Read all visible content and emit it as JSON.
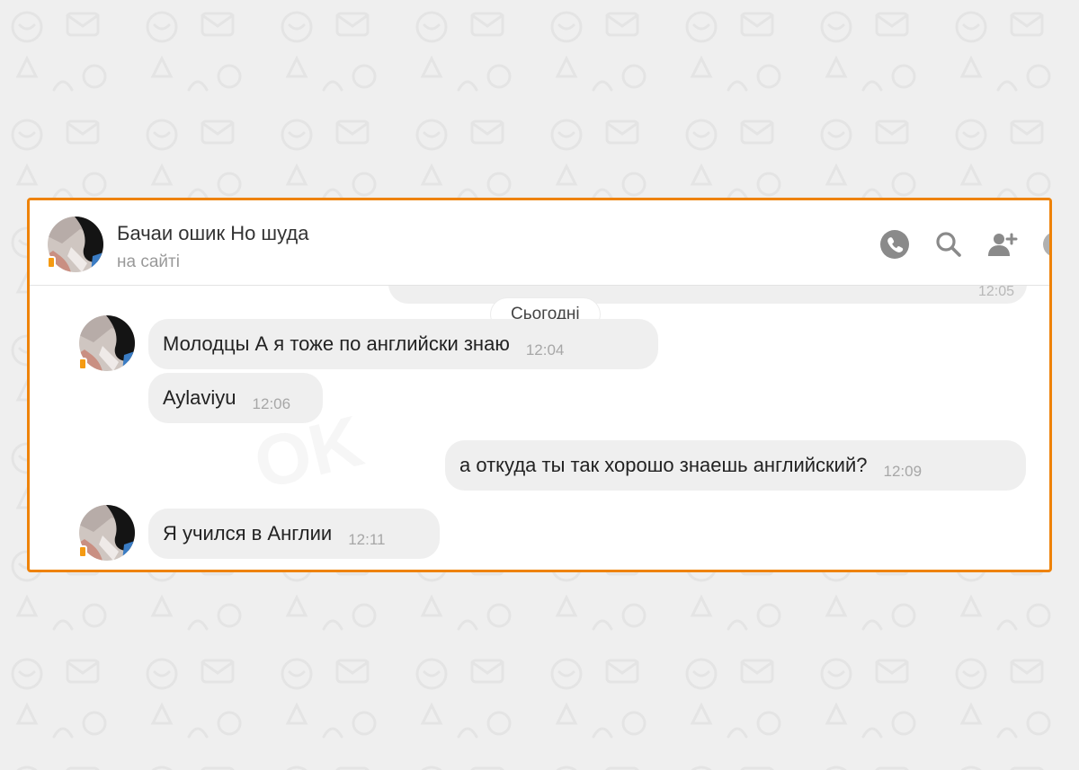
{
  "header": {
    "contact_name": "Бачаи ошик Но шуда",
    "contact_status": "на сайті",
    "icons": [
      "phone-icon",
      "search-icon",
      "add-user-icon"
    ]
  },
  "chat": {
    "previous_time": "12:05",
    "date_label": "Сьогодні",
    "messages": [
      {
        "side": "in",
        "text": "Молодцы А я тоже по английски знаю",
        "time": "12:04"
      },
      {
        "side": "in",
        "text": "Aylaviyu",
        "time": "12:06"
      },
      {
        "side": "out",
        "text": "а откуда ты так хорошо знаешь английский?",
        "time": "12:09"
      },
      {
        "side": "in",
        "text": "Я учился в Англии",
        "time": "12:11"
      }
    ]
  },
  "colors": {
    "frame_border": "#ee8208",
    "bubble_bg": "#efefef",
    "status_dot": "#f59a12",
    "icon": "#8a8a8a"
  }
}
